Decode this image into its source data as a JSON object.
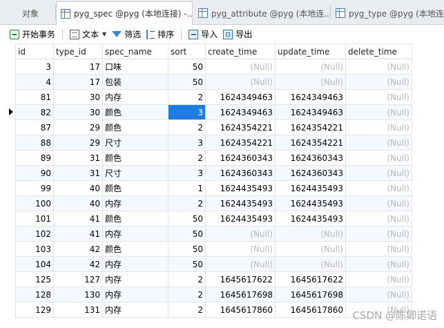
{
  "tabs": [
    {
      "label": "对象",
      "active": false
    },
    {
      "label": "pyg_spec @pyg (本地连接) -...",
      "active": true
    },
    {
      "label": "pyg_attribute @pyg (本地连...",
      "active": false
    },
    {
      "label": "pyg_type @pyg (本地连接",
      "active": false
    }
  ],
  "toolbar": {
    "begin_transaction": "开始事务",
    "text": "文本",
    "filter": "筛选",
    "sort": "排序",
    "import": "导入",
    "export": "导出"
  },
  "columns": [
    "id",
    "type_id",
    "spec_name",
    "sort",
    "create_time",
    "update_time",
    "delete_time"
  ],
  "null_text": "(Null)",
  "rows": [
    [
      "3",
      "17",
      "口味",
      "50",
      null,
      null,
      null
    ],
    [
      "4",
      "17",
      "包装",
      "50",
      null,
      null,
      null
    ],
    [
      "81",
      "30",
      "内存",
      "2",
      "1624349463",
      "1624349463",
      null
    ],
    [
      "82",
      "30",
      "颜色",
      "3",
      "1624349463",
      "1624349463",
      null
    ],
    [
      "87",
      "29",
      "颜色",
      "2",
      "1624354221",
      "1624354221",
      null
    ],
    [
      "88",
      "29",
      "尺寸",
      "3",
      "1624354221",
      "1624354221",
      null
    ],
    [
      "89",
      "31",
      "颜色",
      "2",
      "1624360343",
      "1624360343",
      null
    ],
    [
      "90",
      "31",
      "尺寸",
      "3",
      "1624360343",
      "1624360343",
      null
    ],
    [
      "99",
      "40",
      "颜色",
      "1",
      "1624435493",
      "1624435493",
      null
    ],
    [
      "100",
      "40",
      "内存",
      "2",
      "1624435493",
      "1624435493",
      null
    ],
    [
      "101",
      "41",
      "颜色",
      "50",
      "1624435493",
      "1624435493",
      null
    ],
    [
      "102",
      "41",
      "内存",
      "50",
      null,
      null,
      null
    ],
    [
      "103",
      "42",
      "颜色",
      "50",
      null,
      null,
      null
    ],
    [
      "104",
      "42",
      "内存",
      "50",
      null,
      null,
      null
    ],
    [
      "125",
      "127",
      "内存",
      "2",
      "1645617622",
      "1645617622",
      null
    ],
    [
      "128",
      "130",
      "内存",
      "2",
      "1645617698",
      "1645617698",
      null
    ],
    [
      "129",
      "131",
      "内存",
      "2",
      "1645617860",
      "1645617860",
      null
    ]
  ],
  "current_row": 3,
  "selected_cell": {
    "row": 3,
    "column": 3
  },
  "watermark": "CSDN @陈卿诺语",
  "colors": {
    "selection": "#1e7be0",
    "null_text": "#b8b8b8",
    "alt_row": "#f4f8ff"
  }
}
